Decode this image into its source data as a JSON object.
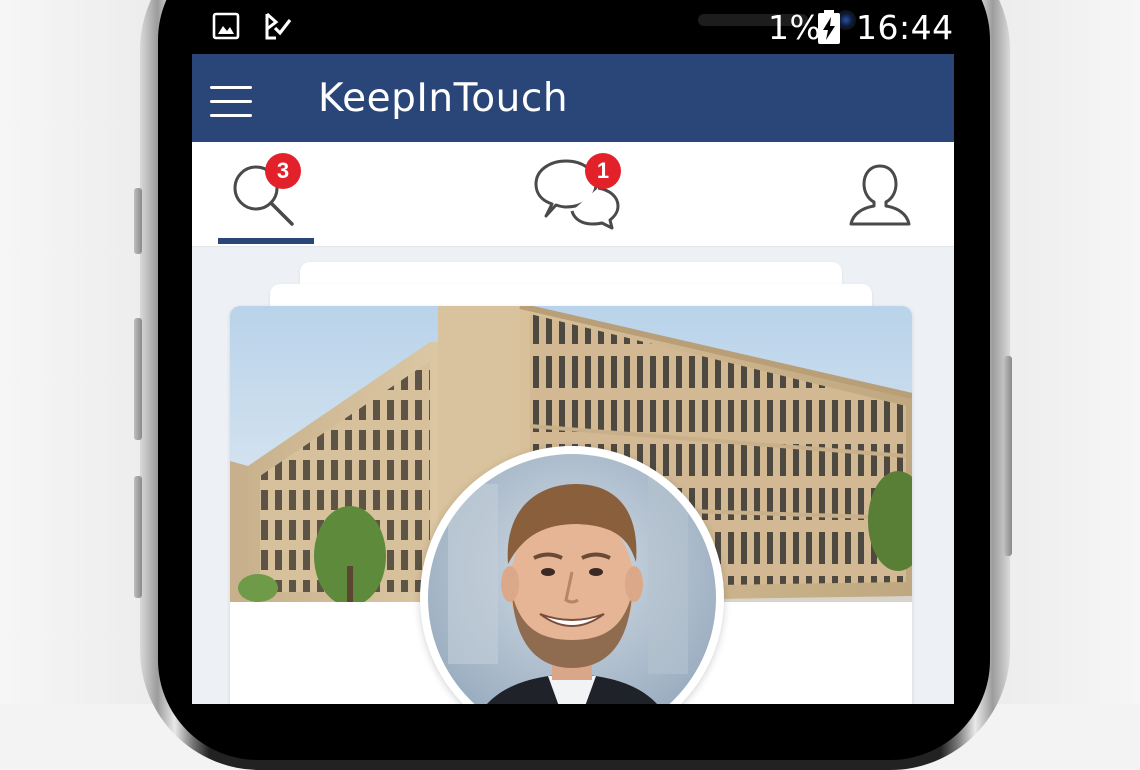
{
  "status_bar": {
    "battery_percent": "1%",
    "time": "16:44",
    "left_icons": [
      "gallery-icon",
      "check-icon"
    ]
  },
  "app_bar": {
    "title": "KeepInTouch",
    "menu_icon": "hamburger-menu-icon",
    "color": "#2a4679"
  },
  "tabs": [
    {
      "id": "search",
      "icon": "search-icon",
      "badge": "3",
      "active": true
    },
    {
      "id": "messages",
      "icon": "chat-bubbles-icon",
      "badge": "1",
      "active": false
    },
    {
      "id": "profile",
      "icon": "user-icon",
      "badge": "",
      "active": false
    }
  ],
  "badge_color": "#e3212b",
  "card": {
    "cover_image": "building-photo",
    "avatar_image": "profile-photo"
  }
}
